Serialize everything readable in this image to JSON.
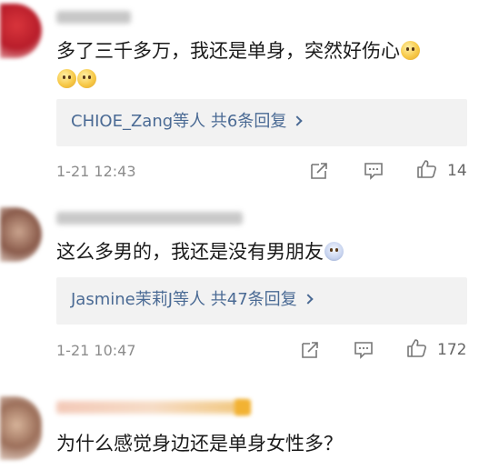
{
  "comments": [
    {
      "text": "多了三千多万，我还是单身，突然好伤心",
      "reply_name": "CHIOE_Zang",
      "reply_suffix": "等人  共6条回复",
      "time": "1-21 12:43",
      "likes": "14"
    },
    {
      "text": "这么多男的，我还是没有男朋友",
      "reply_name": "Jasmine茉莉J",
      "reply_suffix": "等人  共47条回复",
      "time": "1-21 10:47",
      "likes": "172"
    },
    {
      "text": "为什么感觉身边还是单身女性多？"
    }
  ],
  "icons": {
    "share": "share-icon",
    "comment": "comment-icon",
    "like": "thumbs-up-icon"
  }
}
